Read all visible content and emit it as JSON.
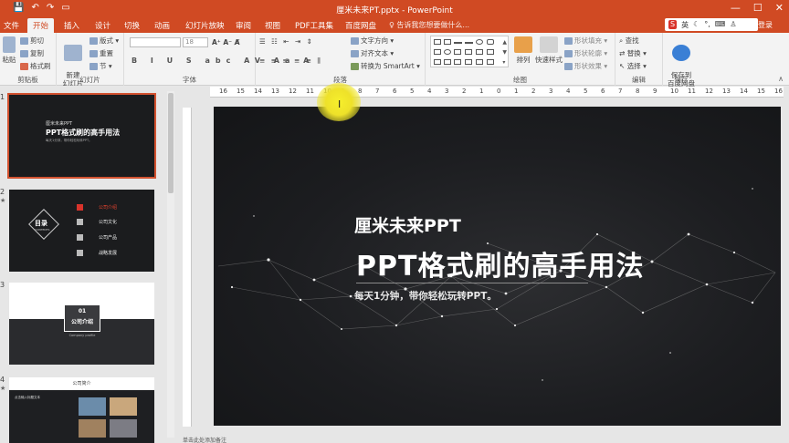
{
  "window": {
    "title": "厘米未来PT.pptx - PowerPoint",
    "login": "登录",
    "controls": [
      "—",
      "☐",
      "✕"
    ]
  },
  "tabs": {
    "file": "文件",
    "items": [
      "开始",
      "插入",
      "设计",
      "切换",
      "动画",
      "幻灯片放映",
      "审阅",
      "视图",
      "PDF工具集",
      "百度网盘"
    ],
    "active": "开始",
    "tell_me": "告诉我您想要做什么..."
  },
  "ime": {
    "logo": "S",
    "lang": "英"
  },
  "ribbon": {
    "clipboard": {
      "paste": "粘贴",
      "cut": "剪切",
      "copy": "复制",
      "format_painter": "格式刷",
      "label": "剪贴板"
    },
    "slides": {
      "new_slide": "新建\n幻灯片",
      "layout": "版式",
      "reset": "重置",
      "section": "节",
      "label": "幻灯片"
    },
    "font": {
      "label": "字体",
      "size": "18",
      "format_buttons": "B I U S abc AV Aa A",
      "align_buttons": "≡ ≡ ≡ ≡ ≡ ⫼"
    },
    "paragraph": {
      "text_direction": "文字方向",
      "align_text": "对齐文本",
      "smartart": "转换为 SmartArt",
      "label": "段落"
    },
    "drawing": {
      "arrange": "排列",
      "quick_styles": "快速样式",
      "fill": "形状填充",
      "outline": "形状轮廓",
      "effects": "形状效果",
      "label": "绘图"
    },
    "editing": {
      "find": "查找",
      "replace": "替换",
      "select": "选择",
      "label": "编辑"
    },
    "save": {
      "save_baidu": "保存到\n百度网盘",
      "label": "保存"
    }
  },
  "ruler_labels": [
    "16",
    "15",
    "14",
    "13",
    "12",
    "11",
    "10",
    "9",
    "8",
    "7",
    "6",
    "5",
    "4",
    "3",
    "2",
    "1",
    "0",
    "1",
    "2",
    "3",
    "4",
    "5",
    "6",
    "7",
    "8",
    "9",
    "10",
    "11",
    "12",
    "13",
    "14",
    "15",
    "16"
  ],
  "thumbnails": [
    {
      "num": "1",
      "sub": "厘米未来PPT",
      "title": "PPT格式刷的高手用法",
      "tag": "每天1分钟，带你轻松玩转PPT。"
    },
    {
      "num": "2",
      "label": "目录",
      "label_en": "CONTENTS",
      "items": [
        "公司介绍",
        "公司文化",
        "公司产品",
        "战略发展"
      ]
    },
    {
      "num": "3",
      "box_num": "01",
      "box_title": "公司介绍",
      "box_sub": "Company profile"
    },
    {
      "num": "4",
      "header": "公司简介",
      "lines": [
        "点击输入标题文本"
      ]
    }
  ],
  "main_slide": {
    "subtitle": "厘米未来PPT",
    "title": "PPT格式刷的高手用法",
    "tagline": "每天1分钟，带你轻松玩转PPT。"
  },
  "notes": "单击此处添加备注"
}
